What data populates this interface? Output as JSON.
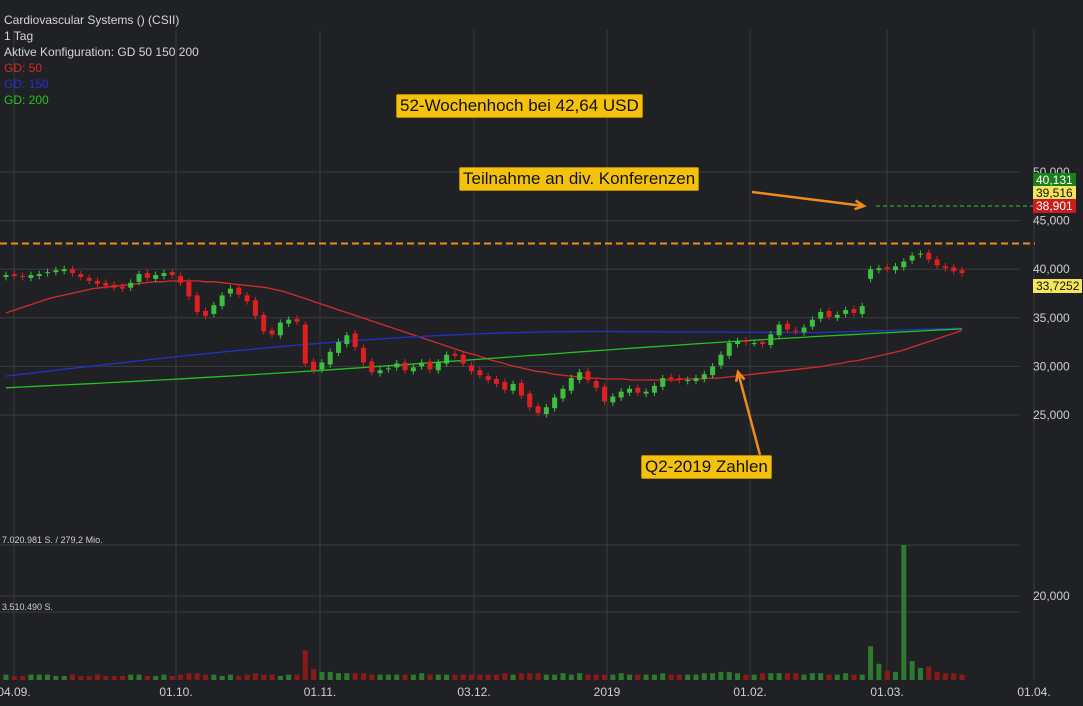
{
  "header": {
    "title": "Cardiovascular Systems () (CSII)",
    "period": "1 Tag",
    "config": "Aktive Konfiguration: GD 50 150 200",
    "ma50_label": "GD: 50",
    "ma150_label": "GD: 150",
    "ma200_label": "GD: 200"
  },
  "colors": {
    "background": "#1f2124",
    "grid": "#3a3c40",
    "up": "#3fbf3f",
    "down": "#e02020",
    "ma50": "#d42a2a",
    "ma150": "#2430c8",
    "ma200": "#22c422",
    "annotation": "#f4c20d",
    "resistance": "#f08a1c"
  },
  "annotations": {
    "high": "52-Wochenhoch bei 42,64 USD",
    "conf": "Teilnahme an div. Konferenzen",
    "q2": "Q2-2019 Zahlen"
  },
  "price_tags": {
    "high": "40,131",
    "last": "39,516",
    "low": "38,901",
    "ma200": "33,7252"
  },
  "volume_labels": {
    "max": "7.020.981 S. / 279,2 Mio.",
    "mid": "3.510.490 S."
  },
  "chart_data": {
    "type": "candlestick",
    "y_ticks": [
      "50,000",
      "45,000",
      "40,000",
      "35,000",
      "30,000",
      "25,000",
      "20,000"
    ],
    "y_tick_values": [
      50,
      45,
      40,
      35,
      30,
      25,
      20
    ],
    "x_ticks": [
      "04.09.",
      "01.10.",
      "01.11.",
      "03.12.",
      "2019",
      "01.02.",
      "01.03.",
      "01.04."
    ],
    "resistance_level": 42.64,
    "volume_max": 7020981,
    "closes": [
      39.4,
      39.3,
      39.2,
      39.4,
      39.5,
      39.7,
      39.9,
      40.0,
      39.6,
      39.2,
      38.8,
      38.5,
      38.3,
      38.1,
      38.0,
      38.6,
      39.5,
      39.1,
      39.4,
      39.6,
      39.4,
      38.6,
      37.2,
      35.6,
      35.2,
      36.3,
      37.3,
      38.0,
      37.4,
      36.7,
      35.2,
      33.6,
      33.3,
      34.5,
      34.8,
      34.6,
      30.3,
      29.6,
      30.4,
      31.5,
      32.5,
      33.2,
      32.0,
      30.4,
      29.4,
      29.6,
      29.8,
      30.3,
      29.6,
      29.9,
      30.4,
      29.7,
      30.4,
      31.2,
      31.1,
      30.3,
      29.5,
      29.1,
      28.6,
      28.2,
      27.6,
      28.2,
      27.0,
      25.8,
      25.2,
      25.8,
      26.8,
      27.7,
      28.8,
      29.4,
      28.6,
      27.8,
      26.4,
      26.9,
      27.4,
      27.7,
      27.3,
      27.4,
      28.0,
      28.8,
      28.7,
      28.6,
      28.6,
      28.8,
      29.2,
      30.0,
      31.2,
      32.4,
      32.6,
      32.5,
      32.4,
      32.3,
      33.3,
      34.3,
      33.8,
      33.6,
      34.0,
      34.8,
      35.6,
      35.1,
      35.3,
      35.8,
      35.5,
      36.2,
      40.0,
      40.1,
      40.0,
      40.3,
      40.8,
      41.4,
      41.6,
      41.0,
      40.4,
      40.1,
      39.8,
      39.6
    ],
    "opens": [
      39.2,
      39.5,
      39.3,
      39.1,
      39.3,
      39.6,
      39.7,
      39.8,
      40.0,
      39.5,
      39.1,
      38.8,
      38.6,
      38.4,
      38.2,
      38.1,
      38.7,
      39.6,
      39.0,
      39.3,
      39.7,
      39.3,
      38.7,
      37.3,
      35.7,
      35.4,
      36.2,
      37.5,
      38.1,
      37.3,
      36.8,
      35.3,
      33.7,
      33.2,
      34.4,
      34.9,
      34.3,
      30.5,
      29.7,
      30.2,
      31.4,
      32.3,
      33.4,
      31.9,
      30.5,
      29.3,
      29.7,
      29.9,
      30.4,
      29.5,
      30.0,
      30.5,
      29.6,
      30.3,
      31.3,
      31.2,
      30.1,
      29.6,
      29.0,
      28.7,
      28.4,
      27.5,
      28.3,
      27.2,
      25.9,
      25.1,
      25.7,
      26.7,
      27.5,
      28.6,
      29.5,
      28.5,
      27.9,
      26.3,
      26.8,
      27.3,
      27.8,
      27.2,
      27.3,
      27.9,
      28.9,
      28.8,
      28.5,
      28.5,
      28.7,
      29.1,
      30.1,
      31.1,
      32.3,
      32.7,
      32.4,
      32.5,
      32.2,
      33.2,
      34.4,
      33.7,
      33.5,
      34.1,
      34.9,
      35.7,
      35.0,
      35.4,
      35.9,
      35.4,
      39.0,
      39.9,
      40.2,
      39.9,
      40.2,
      40.9,
      41.5,
      41.7,
      41.0,
      40.3,
      40.2,
      39.9
    ],
    "volumes": [
      0.04,
      0.03,
      0.03,
      0.04,
      0.04,
      0.04,
      0.03,
      0.03,
      0.04,
      0.03,
      0.03,
      0.04,
      0.03,
      0.03,
      0.03,
      0.04,
      0.04,
      0.03,
      0.03,
      0.04,
      0.03,
      0.04,
      0.05,
      0.05,
      0.04,
      0.04,
      0.03,
      0.04,
      0.03,
      0.04,
      0.05,
      0.04,
      0.04,
      0.03,
      0.04,
      0.04,
      0.22,
      0.08,
      0.06,
      0.06,
      0.05,
      0.05,
      0.05,
      0.05,
      0.04,
      0.04,
      0.04,
      0.04,
      0.04,
      0.04,
      0.05,
      0.04,
      0.04,
      0.04,
      0.04,
      0.04,
      0.04,
      0.04,
      0.04,
      0.04,
      0.05,
      0.04,
      0.05,
      0.05,
      0.05,
      0.04,
      0.04,
      0.05,
      0.04,
      0.05,
      0.04,
      0.04,
      0.04,
      0.04,
      0.05,
      0.04,
      0.04,
      0.04,
      0.04,
      0.05,
      0.04,
      0.04,
      0.04,
      0.04,
      0.05,
      0.05,
      0.06,
      0.06,
      0.05,
      0.04,
      0.04,
      0.05,
      0.05,
      0.05,
      0.05,
      0.05,
      0.04,
      0.05,
      0.05,
      0.04,
      0.04,
      0.05,
      0.04,
      0.04,
      0.25,
      0.12,
      0.07,
      0.06,
      1.0,
      0.14,
      0.09,
      0.1,
      0.06,
      0.05,
      0.05,
      0.04
    ],
    "ma50": [
      35.5,
      35.8,
      36.1,
      36.4,
      36.7,
      37.0,
      37.2,
      37.4,
      37.6,
      37.8,
      38.0,
      38.1,
      38.2,
      38.3,
      38.4,
      38.5,
      38.6,
      38.7,
      38.7,
      38.8,
      38.8,
      38.8,
      38.8,
      38.7,
      38.7,
      38.6,
      38.5,
      38.4,
      38.3,
      38.2,
      38.1,
      37.9,
      37.7,
      37.4,
      37.1,
      36.8,
      36.5,
      36.2,
      35.9,
      35.6,
      35.3,
      35.0,
      34.7,
      34.4,
      34.1,
      33.8,
      33.5,
      33.2,
      32.9,
      32.6,
      32.3,
      32.0,
      31.7,
      31.4,
      31.2,
      30.9,
      30.6,
      30.4,
      30.1,
      29.9,
      29.7,
      29.5,
      29.4,
      29.2,
      29.1,
      29.0,
      28.9,
      28.8,
      28.8,
      28.7,
      28.7,
      28.7,
      28.6,
      28.6,
      28.6,
      28.6,
      28.6,
      28.6,
      28.7,
      28.7,
      28.7,
      28.8,
      28.8,
      28.9,
      29.0,
      29.1,
      29.2,
      29.3,
      29.4,
      29.5,
      29.6,
      29.7,
      29.8,
      29.9,
      30.0,
      30.2,
      30.3,
      30.5,
      30.6,
      30.8,
      31.0,
      31.2,
      31.4,
      31.6,
      31.9,
      32.2,
      32.5,
      32.8,
      33.1,
      33.4,
      33.7
    ]
  }
}
